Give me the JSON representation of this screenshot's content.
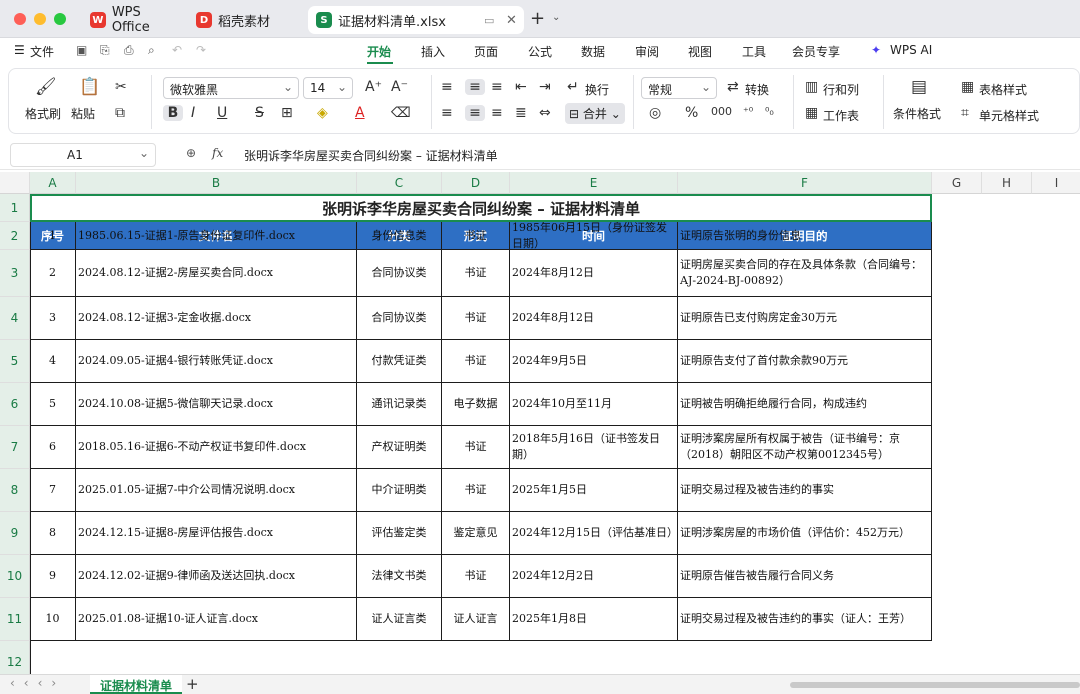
{
  "window": {
    "tabs": [
      {
        "label": "WPS Office",
        "icon": "wps-logo"
      },
      {
        "label": "稻壳素材",
        "icon": "docer-logo"
      },
      {
        "label": "证据材料清单.xlsx",
        "icon": "sheet-logo"
      }
    ],
    "new_tab": "+"
  },
  "menu": {
    "file": "文件",
    "items": [
      "开始",
      "插入",
      "页面",
      "公式",
      "数据",
      "审阅",
      "视图",
      "工具",
      "会员专享"
    ],
    "ai": "WPS AI"
  },
  "ribbon": {
    "format_painter": "格式刷",
    "paste": "粘贴",
    "font_name": "微软雅黑",
    "font_size": "14",
    "bold": "B",
    "italic": "I",
    "underline": "U",
    "strike": "S",
    "wrap": "换行",
    "merge": "合并",
    "number_format": "常规",
    "convert": "转换",
    "rows_cols": "行和列",
    "worksheet": "工作表",
    "cond_format": "条件格式",
    "table_style": "表格样式",
    "cell_style": "单元格样式",
    "percent": "%"
  },
  "formula": {
    "cell_ref": "A1",
    "fx": "fx",
    "content": "张明诉李华房屋买卖合同纠纷案 – 证据材料清单"
  },
  "sheet": {
    "columns": [
      "A",
      "B",
      "C",
      "D",
      "E",
      "F",
      "G",
      "H",
      "I"
    ],
    "rows": [
      "1",
      "2",
      "3",
      "4",
      "5",
      "6",
      "7",
      "8",
      "9",
      "10",
      "11",
      "12"
    ],
    "title": "张明诉李华房屋买卖合同纠纷案 – 证据材料清单",
    "headers": [
      "序号",
      "文件名",
      "分类",
      "形式",
      "时间",
      "证明目的"
    ],
    "data": [
      [
        "1",
        "1985.06.15-证据1-原告身份证复印件.docx",
        "身份信息类",
        "书证",
        "1985年06月15日（身份证签发日期）",
        "证明原告张明的身份信息"
      ],
      [
        "2",
        "2024.08.12-证据2-房屋买卖合同.docx",
        "合同协议类",
        "书证",
        "2024年8月12日",
        "证明房屋买卖合同的存在及具体条款（合同编号：AJ-2024-BJ-00892）"
      ],
      [
        "3",
        "2024.08.12-证据3-定金收据.docx",
        "合同协议类",
        "书证",
        "2024年8月12日",
        "证明原告已支付购房定金30万元"
      ],
      [
        "4",
        "2024.09.05-证据4-银行转账凭证.docx",
        "付款凭证类",
        "书证",
        "2024年9月5日",
        "证明原告支付了首付款余款90万元"
      ],
      [
        "5",
        "2024.10.08-证据5-微信聊天记录.docx",
        "通讯记录类",
        "电子数据",
        "2024年10月至11月",
        "证明被告明确拒绝履行合同，构成违约"
      ],
      [
        "6",
        "2018.05.16-证据6-不动产权证书复印件.docx",
        "产权证明类",
        "书证",
        "2018年5月16日（证书签发日期）",
        "证明涉案房屋所有权属于被告（证书编号：京（2018）朝阳区不动产权第0012345号）"
      ],
      [
        "7",
        "2025.01.05-证据7-中介公司情况说明.docx",
        "中介证明类",
        "书证",
        "2025年1月5日",
        "证明交易过程及被告违约的事实"
      ],
      [
        "8",
        "2024.12.15-证据8-房屋评估报告.docx",
        "评估鉴定类",
        "鉴定意见",
        "2024年12月15日（评估基准日）",
        "证明涉案房屋的市场价值（评估价：452万元）"
      ],
      [
        "9",
        "2024.12.02-证据9-律师函及送达回执.docx",
        "法律文书类",
        "书证",
        "2024年12月2日",
        "证明原告催告被告履行合同义务"
      ],
      [
        "10",
        "2025.01.08-证据10-证人证言.docx",
        "证人证言类",
        "证人证言",
        "2025年1月8日",
        "证明交易过程及被告违约的事实（证人：王芳）"
      ]
    ]
  },
  "sheet_tabs": {
    "active": "证据材料清单",
    "add": "+"
  },
  "colors": {
    "accent": "#1a8c4e",
    "header_fill": "#2e6fc4"
  }
}
